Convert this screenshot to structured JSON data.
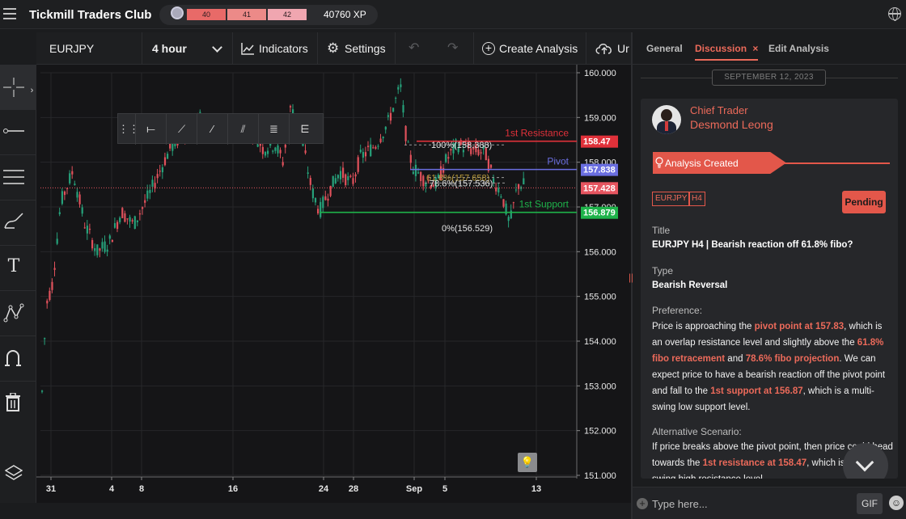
{
  "topbar": {
    "brand": "Tickmill Traders Club",
    "levels": [
      "40",
      "41",
      "42"
    ],
    "xp": "40760 XP"
  },
  "toolbar": {
    "symbol": "EURJPY",
    "timeframe": "4 hour",
    "indicators": "Indicators",
    "settings": "Settings",
    "create_analysis": "Create Analysis",
    "upload_partial": "Ur"
  },
  "left_tools": [
    "crosshair-icon",
    "horizontal-line-icon",
    "parallel-channel-icon",
    "brush-icon",
    "text-icon",
    "pattern-icon",
    "magnet-icon",
    "trash-icon"
  ],
  "chart_data": {
    "type": "candlestick",
    "x_ticks": [
      "31",
      "4",
      "8",
      "16",
      "24",
      "28",
      "Sep",
      "5",
      "13"
    ],
    "y_ticks": [
      "160.000",
      "159.000",
      "158.000",
      "157.000",
      "156.000",
      "155.000",
      "154.000",
      "153.000",
      "152.000",
      "151.000"
    ],
    "ylim": [
      151.0,
      160.0
    ],
    "levels": [
      {
        "name": "1st Resistance",
        "value": 158.47,
        "label": "158.47",
        "color": "#e0313a"
      },
      {
        "name": "Pivot",
        "value": 157.838,
        "label": "157.838",
        "color": "#6a6ee0"
      },
      {
        "name": "current",
        "value": 157.428,
        "label": "157.428",
        "color": "#e65560"
      },
      {
        "name": "1st Support",
        "value": 156.879,
        "label": "156.879",
        "color": "#1eb34a"
      }
    ],
    "fib_labels": [
      "100%(158.388)",
      "61.8%(157.658)",
      "78.6%(157.536)",
      "0%(156.529)"
    ]
  },
  "panel": {
    "tabs": [
      "General",
      "Discussion",
      "Edit Analysis"
    ],
    "close_mark": "×",
    "date": "SEPTEMBER 12, 2023",
    "role": "Chief Trader",
    "author": "Desmond Leong",
    "status": "Analysis Created",
    "tags": [
      "EURJPY",
      "H4"
    ],
    "pending": "Pending",
    "title_label": "Title",
    "title": "EURJPY H4 | Bearish reaction off 61.8% fibo?",
    "type_label": "Type",
    "type": "Bearish Reversal",
    "preference_label": "Preference:",
    "pref": {
      "t1": "Price is approaching the ",
      "h1": "pivot point at 157.83",
      "t2": ", which is an overlap resistance level and slightly above the ",
      "h2": "61.8% fibo retracement",
      "t3": " and ",
      "h3": "78.6% fibo projection",
      "t4": ". We can expect price to have a bearish reaction off the pivot point and fall to the ",
      "h4": "1st support at 156.87",
      "t5": ", which is a multi-swing low support level."
    },
    "alt_label": "Alternative Scenario:",
    "alt": {
      "t1": "If price breaks above the pivot point, then price could head towards the ",
      "h1": "1st resistance at 158.47",
      "t2": ", which is a multi-swing high resistance level."
    },
    "input_placeholder": "Type here...",
    "gif": "GIF"
  }
}
